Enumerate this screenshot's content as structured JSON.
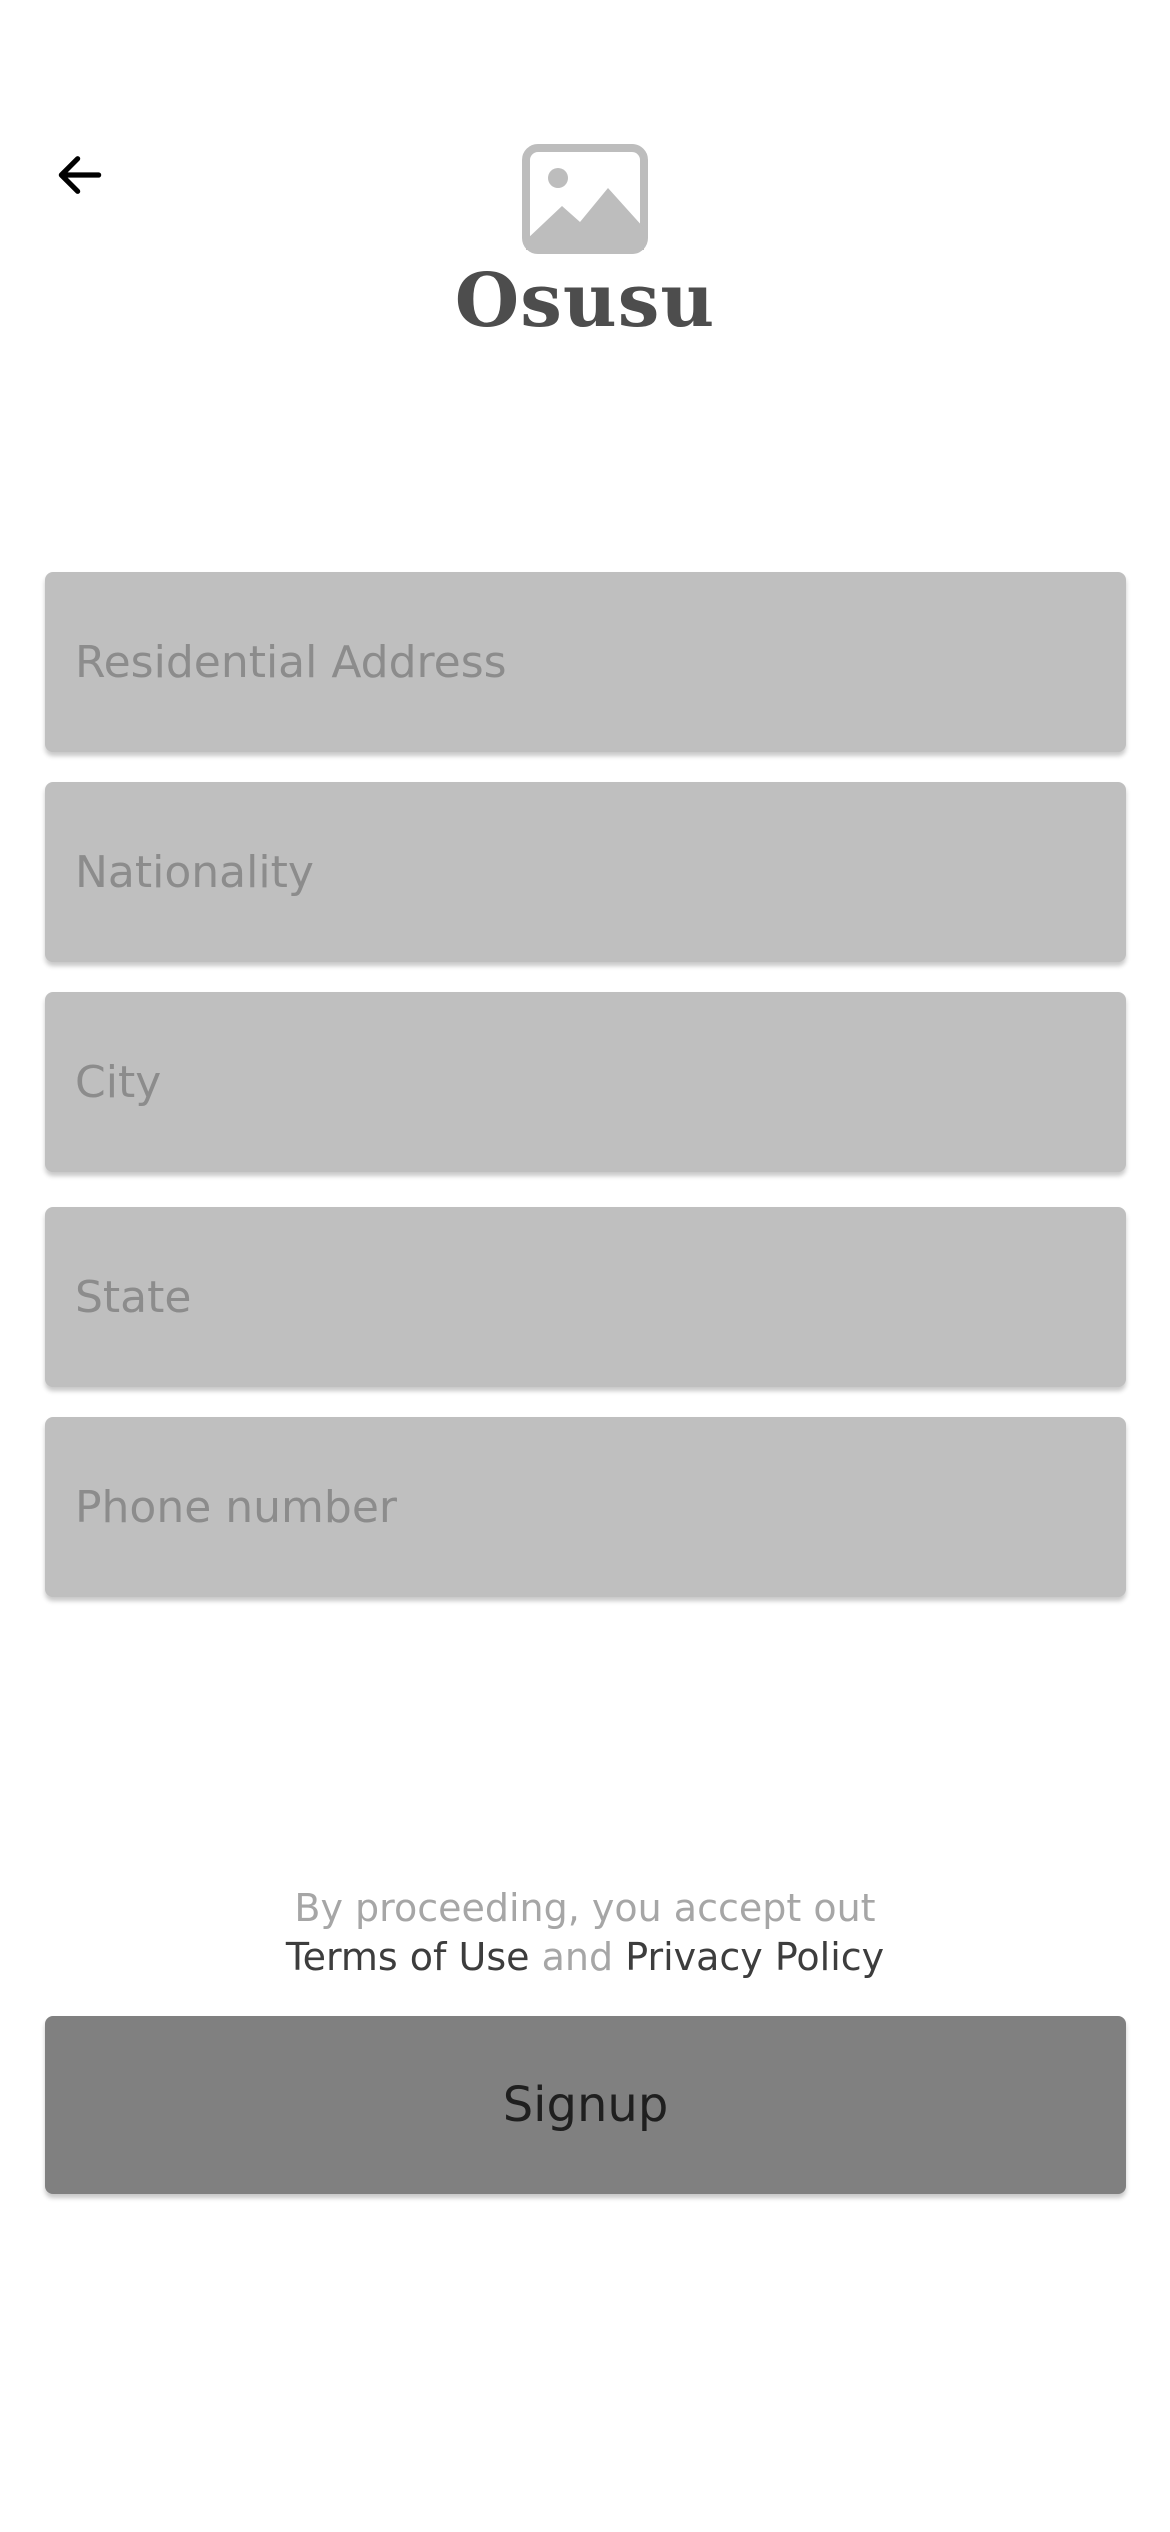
{
  "header": {
    "back_icon": "arrow-left-icon",
    "logo_icon": "image-placeholder-icon",
    "brand_name": "Osusu"
  },
  "form": {
    "residential_address": {
      "placeholder": "Residential Address",
      "value": ""
    },
    "nationality": {
      "placeholder": "Nationality",
      "value": ""
    },
    "city": {
      "placeholder": "City",
      "value": ""
    },
    "state": {
      "placeholder": "State",
      "value": ""
    },
    "phone_number": {
      "placeholder": "Phone number",
      "value": ""
    }
  },
  "legal": {
    "line1": "By proceeding, you accept out",
    "terms_link": "Terms of Use",
    "and_text": "and",
    "privacy_link": "Privacy Policy"
  },
  "actions": {
    "signup_label": "Signup"
  },
  "colors": {
    "field_background": "#bfbfbf",
    "button_background": "#808080",
    "brand_text": "#4d4d4d",
    "placeholder_text": "#8c8c8c"
  }
}
